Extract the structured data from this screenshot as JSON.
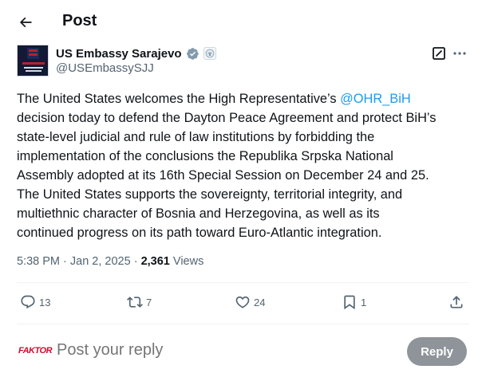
{
  "header": {
    "back_icon": "arrow-left-icon",
    "title": "Post"
  },
  "author": {
    "display_name": "US Embassy Sarajevo",
    "handle": "@USEmbassySJJ",
    "avatar_icon": "embassy-seal-logo",
    "verified_icon": "government-verified-badge-icon",
    "affiliate_icon": "us-government-affiliate-icon"
  },
  "post": {
    "lines": [
      {
        "before": "The United States welcomes the High Representative’s ",
        "mention": "@OHR_BiH",
        "after": ""
      },
      {
        "before": "decision today to defend the Dayton Peace Agreement and protect BiH’s"
      },
      {
        "before": "state-level judicial and rule of law institutions by forbidding the"
      },
      {
        "before": "implementation of the conclusions the Republika Srpska National"
      },
      {
        "before": "Assembly adopted at its 16th Special Session on December 24 and 25."
      },
      {
        "before": "The United States supports the sovereignty, territorial integrity, and"
      },
      {
        "before": "multiethnic character of Bosnia and Herzegovina, as well as its"
      },
      {
        "before": "continued progress on its path toward Euro-Atlantic integration."
      }
    ],
    "meta": {
      "time": "5:38 PM",
      "separator": " · ",
      "date": "Jan 2, 2025",
      "views_count": "2,361",
      "views_label": " Views"
    }
  },
  "actions": {
    "replies": "13",
    "reposts": "7",
    "likes": "24",
    "bookmarks": "1"
  },
  "reply_box": {
    "avatar_text": "FAKTOR",
    "placeholder": "Post your reply",
    "button_label": "Reply"
  },
  "colors": {
    "accent": "#1d9bf0",
    "muted": "#536471",
    "reply_button_disabled": "#8e9499"
  }
}
